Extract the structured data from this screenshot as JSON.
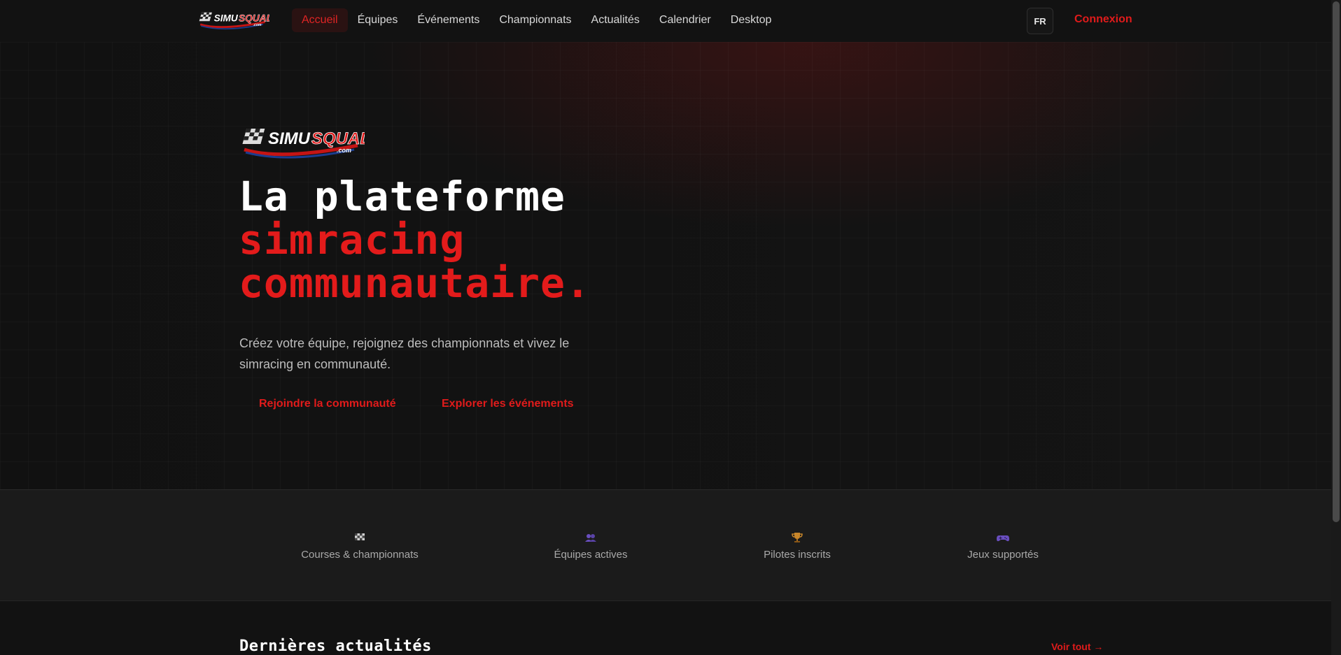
{
  "brand": {
    "name": "SIMUSQUAD",
    "domain_suffix": ".com",
    "accent": "#e01b1b"
  },
  "nav": {
    "links": [
      {
        "label": "Accueil",
        "active": true
      },
      {
        "label": "Équipes"
      },
      {
        "label": "Événements"
      },
      {
        "label": "Championnats"
      },
      {
        "label": "Actualités"
      },
      {
        "label": "Calendrier"
      },
      {
        "label": "Desktop"
      }
    ],
    "language": "FR",
    "login": "Connexion"
  },
  "hero": {
    "title_line1": "La plateforme",
    "title_line2": "simracing",
    "title_line3": "communautaire.",
    "subtitle": "Créez votre équipe, rejoignez des championnats et vivez le simracing en communauté.",
    "cta_primary": "Rejoindre la communauté",
    "cta_secondary": "Explorer les événements"
  },
  "stats": [
    {
      "icon": "checkered-flag-icon",
      "label": "Courses & championnats"
    },
    {
      "icon": "users-icon",
      "label": "Équipes actives"
    },
    {
      "icon": "trophy-icon",
      "label": "Pilotes inscrits"
    },
    {
      "icon": "gamepad-icon",
      "label": "Jeux supportés"
    }
  ],
  "news": {
    "title": "Dernières actualités",
    "see_all": "Voir tout →"
  }
}
